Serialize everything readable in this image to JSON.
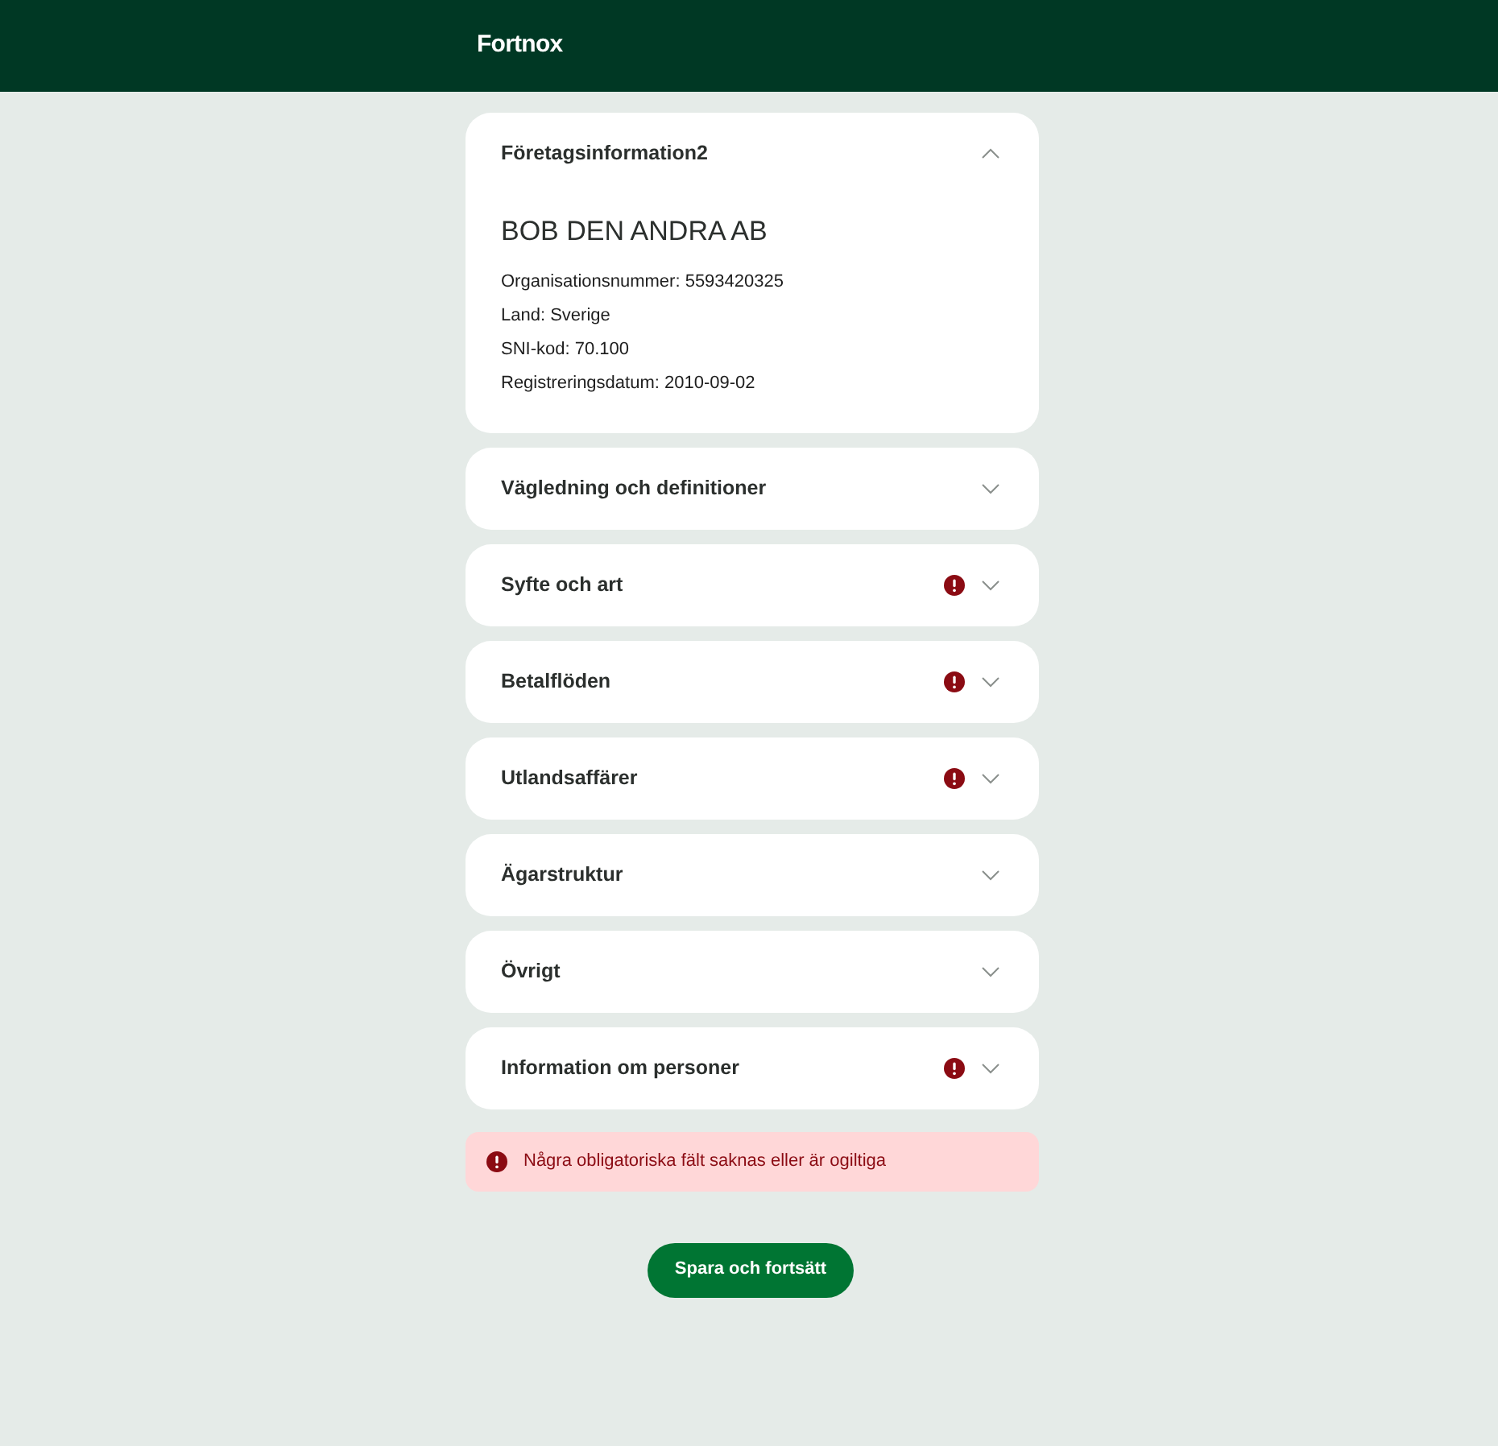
{
  "header": {
    "logo": "Fortnox"
  },
  "sections": [
    {
      "title": "Företagsinformation2",
      "expanded": true,
      "error": false,
      "company": "BOB DEN ANDRA AB",
      "details": [
        "Organisationsnummer: 5593420325",
        "Land: Sverige",
        "SNI-kod: 70.100",
        "Registreringsdatum: 2010-09-02"
      ]
    },
    {
      "title": "Vägledning och definitioner",
      "expanded": false,
      "error": false
    },
    {
      "title": "Syfte och art",
      "expanded": false,
      "error": true
    },
    {
      "title": "Betalflöden",
      "expanded": false,
      "error": true
    },
    {
      "title": "Utlandsaffärer",
      "expanded": false,
      "error": true
    },
    {
      "title": "Ägarstruktur",
      "expanded": false,
      "error": false
    },
    {
      "title": "Övrigt",
      "expanded": false,
      "error": false
    },
    {
      "title": "Information om personer",
      "expanded": false,
      "error": true
    }
  ],
  "alert": {
    "message": "Några obligatoriska fält saknas eller är ogiltiga"
  },
  "buttons": [
    "Spara och fortsätt"
  ]
}
